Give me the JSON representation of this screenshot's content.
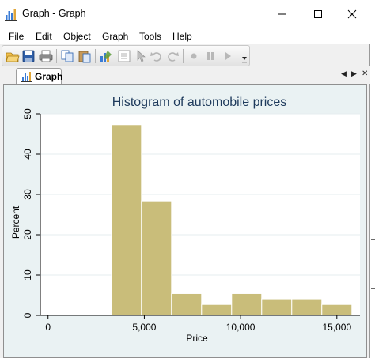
{
  "window": {
    "title": "Graph - Graph",
    "controls": {
      "minimize": "minimize",
      "maximize": "maximize",
      "close": "close"
    }
  },
  "menu": {
    "items": [
      "File",
      "Edit",
      "Object",
      "Graph",
      "Tools",
      "Help"
    ]
  },
  "toolbar": {
    "buttons": [
      "open-icon",
      "save-icon",
      "print-icon",
      "copy-icon",
      "paste-icon",
      "graph-editor-icon",
      "properties-icon",
      "pointer-icon",
      "undo-icon",
      "redo-icon",
      "record-icon",
      "pause-icon",
      "play-icon"
    ]
  },
  "tab": {
    "label": "Graph",
    "nav_left": "◀",
    "nav_right": "▶",
    "close": "✕"
  },
  "colors": {
    "bar_fill": "#c9bd7a",
    "bar_edge": "#b3a85f",
    "plot_bg": "#ffffff",
    "graph_bg": "#eaf2f3",
    "title_color": "#1e3a5c"
  },
  "chart_data": {
    "type": "bar",
    "title": "Histogram of automobile prices",
    "xlabel": "Price",
    "ylabel": "Percent",
    "xlim": [
      -400,
      16200
    ],
    "ylim": [
      0,
      50
    ],
    "x_ticks": [
      0,
      5000,
      10000,
      15000
    ],
    "x_tick_labels": [
      "0",
      "5,000",
      "10,000",
      "15,000"
    ],
    "y_ticks": [
      0,
      10,
      20,
      30,
      40,
      50
    ],
    "y_tick_labels": [
      "0",
      "10",
      "20",
      "30",
      "40",
      "50"
    ],
    "bin_width": 1561,
    "bins": [
      {
        "start": 3291,
        "end": 4852,
        "value": 47.3
      },
      {
        "start": 4852,
        "end": 6413,
        "value": 28.4
      },
      {
        "start": 6413,
        "end": 7974,
        "value": 5.4
      },
      {
        "start": 7974,
        "end": 9535,
        "value": 2.7
      },
      {
        "start": 9535,
        "end": 11096,
        "value": 5.4
      },
      {
        "start": 11096,
        "end": 12657,
        "value": 4.1
      },
      {
        "start": 12657,
        "end": 14218,
        "value": 4.1
      },
      {
        "start": 14218,
        "end": 15779,
        "value": 2.7
      }
    ],
    "grid": true
  }
}
